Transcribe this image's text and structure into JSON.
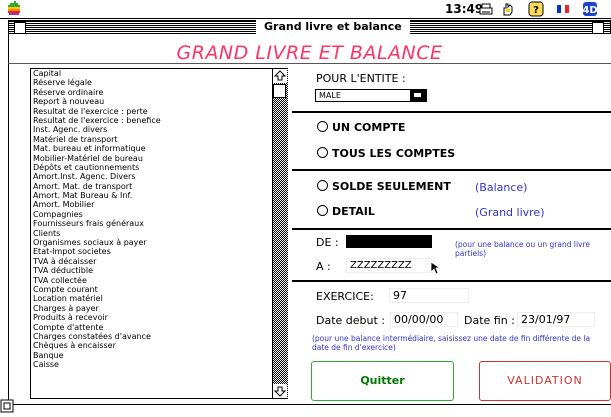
{
  "menubar": {
    "clock": "13:49"
  },
  "window": {
    "title": "Grand livre et balance"
  },
  "heading": "GRAND LIVRE ET BALANCE",
  "accounts": [
    "Capital",
    "Réserve légale",
    "Réserve ordinaire",
    "Report à nouveau",
    "Resultat de l'exercice : perte",
    "Resultat de l'exercice : benefice",
    "Inst. Agenc. divers",
    "Matériel de transport",
    "Mat. bureau et informatique",
    "Mobilier-Matériel de bureau",
    "Dépôts et cautionnements",
    "Amort.Inst. Agenc. Divers",
    "Amort. Mat. de transport",
    "Amort. Mat Bureau & Inf.",
    "Amort. Mobilier",
    "Compagnies",
    "Fournisseurs frais généraux",
    "Clients",
    "Organismes sociaux à payer",
    "Etat-Impot societes",
    "TVA à décaisser",
    "TVA déductible",
    "TVA collectée",
    "Compte courant",
    "Location matériel",
    "Charges à payer",
    "Produits à recevoir",
    "Compte d'attente",
    "Charges constatées d'avance",
    "Chèques à encaisser",
    "Banque",
    "Caisse"
  ],
  "entity": {
    "label": "POUR L'ENTITE :",
    "selected": "MALE"
  },
  "scope": {
    "one_account": "UN COMPTE",
    "all_accounts": "TOUS LES COMPTES"
  },
  "mode": {
    "balance_only": "SOLDE SEULEMENT",
    "balance_hint": "(Balance)",
    "detail": "DETAIL",
    "detail_hint": "(Grand livre)"
  },
  "range": {
    "from_label": "DE :",
    "from_value": "",
    "to_label": "A :",
    "to_value": "ZZZZZZZZZ",
    "hint": "(pour une balance ou un grand livre partiels)"
  },
  "exercise": {
    "label": "EXERCICE:",
    "value": "97",
    "start_label": "Date debut :",
    "start_value": "00/00/00",
    "end_label": "Date fin :",
    "end_value": "23/01/97",
    "hint": "(pour une balance intermédiaire, saisissez une date de fin différente de la date de fin d'exercice)"
  },
  "buttons": {
    "quit": "Quitter",
    "validate": "VALIDATION"
  }
}
